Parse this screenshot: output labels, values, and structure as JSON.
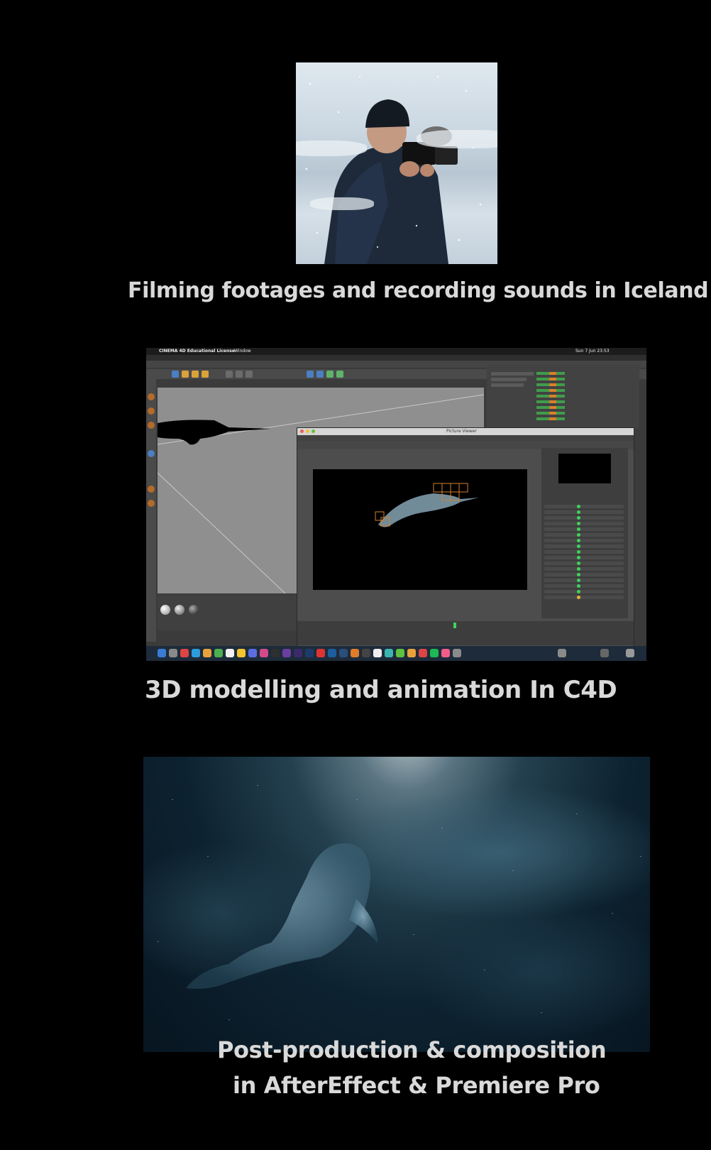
{
  "captions": {
    "filming": "Filming footages and recording sounds in Iceland",
    "modelling": "3D modelling and animation In C4D",
    "post_line1": "Post-production & composition",
    "post_line2": "in AfterEffect & Premiere Pro"
  },
  "c4d_screenshot": {
    "menubar_app": "CINEMA 4D Educational License",
    "menubar_window": "Window",
    "menubar_clock": "Sun 7 Jun 23:53",
    "picture_viewer_title": "Picture Viewer"
  }
}
